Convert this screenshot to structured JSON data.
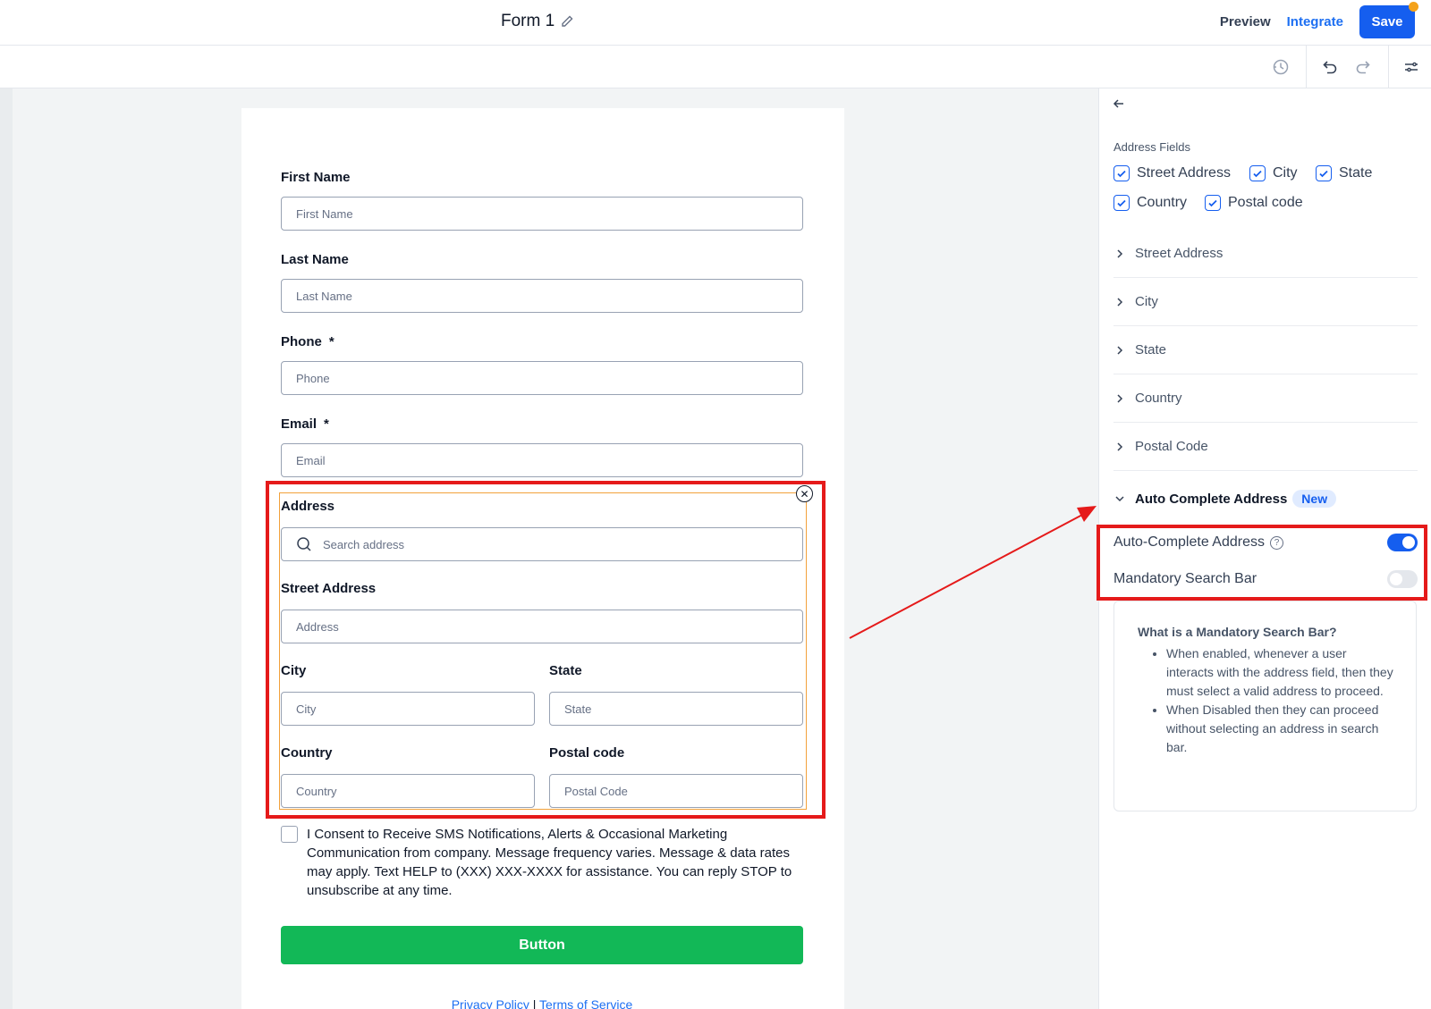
{
  "header": {
    "form_title": "Form 1",
    "preview_label": "Preview",
    "integrate_label": "Integrate",
    "save_label": "Save"
  },
  "form": {
    "first_name": {
      "label": "First Name",
      "placeholder": "First Name"
    },
    "last_name": {
      "label": "Last Name",
      "placeholder": "Last Name"
    },
    "phone": {
      "label": "Phone",
      "required_mark": "*",
      "placeholder": "Phone"
    },
    "email": {
      "label": "Email",
      "required_mark": "*",
      "placeholder": "Email"
    },
    "address": {
      "label": "Address",
      "search_placeholder": "Search address",
      "street_label": "Street Address",
      "street_placeholder": "Address",
      "city_label": "City",
      "city_placeholder": "City",
      "state_label": "State",
      "state_placeholder": "State",
      "country_label": "Country",
      "country_placeholder": "Country",
      "postal_label": "Postal code",
      "postal_placeholder": "Postal Code"
    },
    "consent_text": "I Consent to Receive SMS Notifications, Alerts & Occasional Marketing Communication from company. Message frequency varies. Message & data rates may apply. Text HELP to (XXX) XXX-XXXX for assistance. You can reply STOP to unsubscribe at any time.",
    "button_label": "Button",
    "privacy_link": "Privacy Policy",
    "link_separator": "|",
    "terms_link": "Terms of Service"
  },
  "panel": {
    "section_title": "Address Fields",
    "checkboxes": [
      {
        "label": "Street Address",
        "checked": true
      },
      {
        "label": "City",
        "checked": true
      },
      {
        "label": "State",
        "checked": true
      },
      {
        "label": "Country",
        "checked": true
      },
      {
        "label": "Postal code",
        "checked": true
      }
    ],
    "accordions": [
      "Street Address",
      "City",
      "State",
      "Country",
      "Postal Code"
    ],
    "auto_complete_section": {
      "label": "Auto Complete Address",
      "badge": "New"
    },
    "toggles": [
      {
        "label": "Auto-Complete Address",
        "on": true
      },
      {
        "label": "Mandatory Search Bar",
        "on": false
      }
    ],
    "info": {
      "title": "What is a Mandatory Search Bar?",
      "bullets": [
        "When enabled, whenever a user interacts with the address field, then they must select a valid address to proceed.",
        "When Disabled then they can proceed without selecting an address in search bar."
      ]
    }
  },
  "colors": {
    "primary": "#155eef",
    "submit_button": "#12b857",
    "highlight_red": "#e51a1a",
    "selected_outline": "#f2a13b"
  }
}
